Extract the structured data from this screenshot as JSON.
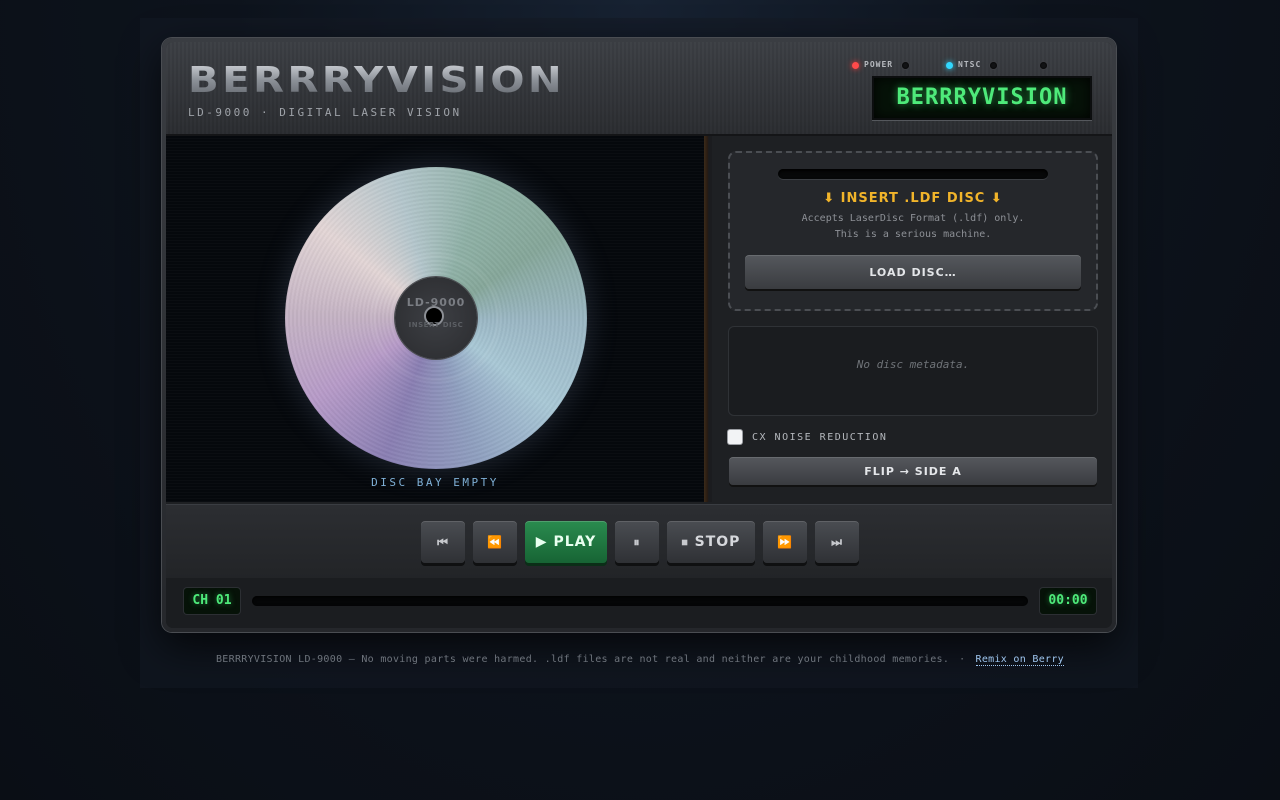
{
  "header": {
    "brand": "BERRRYVISION",
    "model_line": "LD-9000  ·  DIGITAL LASER VISION",
    "indicators": [
      {
        "label": "POWER",
        "color": "#ff4a4a",
        "on": true
      },
      {
        "label": "NTSC",
        "color": "#31d8ff",
        "on": true
      }
    ],
    "lcd_text": "BERRRYVISION"
  },
  "disc_bay": {
    "hub_model": "LD-9000",
    "hub_sub": "INSERT DISC",
    "status": "DISC BAY EMPTY"
  },
  "loader": {
    "title": "⬇ INSERT .LDF DISC ⬇",
    "desc_line1": "Accepts LaserDisc Format (.ldf) only.",
    "desc_line2": "This is a serious machine.",
    "load_button": "LOAD DISC…"
  },
  "metadata": {
    "empty_text": "No disc metadata."
  },
  "options": {
    "cx_label": "CX NOISE REDUCTION",
    "cx_checked": false,
    "flip_button": "FLIP → SIDE A"
  },
  "transport": {
    "play_label": "PLAY",
    "stop_label": "STOP",
    "icons": {
      "skip_back": "⏮",
      "rewind": "⏪",
      "play": "▶",
      "pause": "⏸",
      "stop": "⏹",
      "fast_forward": "⏩",
      "skip_forward": "⏭"
    }
  },
  "status": {
    "chapter": "CH 01",
    "progress": 0,
    "timecode": "00:00"
  },
  "footer": {
    "text": "BERRRYVISION LD-9000 — No moving parts were harmed. .ldf files are not real and neither are your childhood memories.",
    "separator": "·",
    "link": "Remix on Berry"
  },
  "colors": {
    "accent_green": "#4eea7a",
    "warning_amber": "#f1b42a",
    "play_green": "#1f7a42"
  }
}
